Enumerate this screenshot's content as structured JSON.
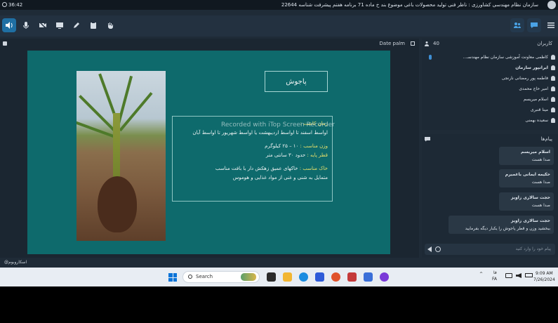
{
  "titlebar": {
    "time": "36:42",
    "title": "سازمان نظام مهندسی کشاورزی : ناظر فنی تولید محصولات باغی موضوع بند خ ماده 71 برنامه هفتم پیشرفت شناسه 22644"
  },
  "toolbar": {
    "left_icons": [
      "speaker-icon",
      "mic-icon",
      "camera-off-icon",
      "screen-share-icon",
      "pen-icon",
      "clipboard-icon",
      "raise-hand-icon"
    ],
    "right_icons": [
      "users-icon",
      "chat-icon",
      "menu-icon"
    ]
  },
  "presentation": {
    "header_label": "Date palm",
    "slide": {
      "title": "پاجوش",
      "watermark": "Recorded with iTop Screen Recorder",
      "line1_label": "زمان کاشت : ",
      "line1": "اواسط اسفند تا اواسط اردیبهشت یا اواسط شهریور تا اواسط آبان",
      "line2_label": "وزن مناسب : ",
      "line2": "۱۰ – ۲۵ کیلوگرم",
      "line3_label": "قطر پایه : ",
      "line3": "حدود ۳۰ سانتی متر",
      "line4_label": "خاک مناسب : ",
      "line4": "خاکهای عمیق زهکش دار با بافت مناسب",
      "line5": "متمایل به شنی و غنی از مواد غذایی و هوموس"
    }
  },
  "users_panel": {
    "label": "کاربران",
    "count": "40",
    "users": [
      "کاظمی معاونت آموزشی سازمان نظام مهندسـ...",
      "ایرانپور سازمان",
      "فاطمه پور رمضانی نارنجی",
      "امیر حاج محمدی",
      "اسلام میریسم",
      "مینا قنبری",
      "سعیده بهمنی"
    ]
  },
  "chat_panel": {
    "label": "پیام‌ها",
    "messages": [
      {
        "name": "اسلام میریسم",
        "text": "صدا هست"
      },
      {
        "name": "حکیمه ایمانی باغمیرم",
        "text": "صدا هست"
      },
      {
        "name": "حجت سالاری زاویز",
        "text": "صدا هست"
      },
      {
        "name": "حجت سالاری زاویز",
        "text": "ببخشید وزن و قطر پاجوش را یکبار دیگه بفرمایید"
      }
    ],
    "input_placeholder": "پیام خود را وارد کنید"
  },
  "statusbar": {
    "text": "@اسکاروبوم"
  },
  "taskbar": {
    "search_label": "Search",
    "time": "9:09 AM",
    "date": "7/26/2024",
    "lang_top": "فا",
    "lang": "FA",
    "app_colors": [
      "#2b2b2b",
      "#f2b632",
      "#1a8ce0",
      "#2e5bd8",
      "#e0532b",
      "#c43a3a",
      "#3a6fd8",
      "#7a3ad8"
    ]
  }
}
